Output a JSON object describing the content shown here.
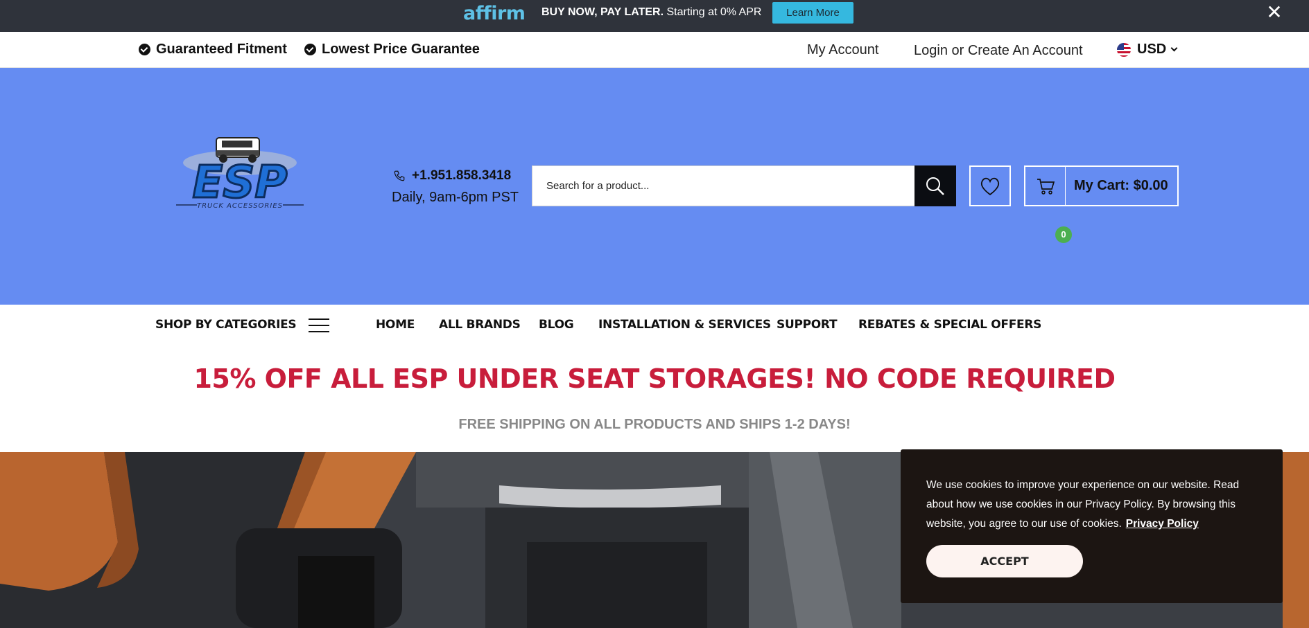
{
  "promo": {
    "brand": "affirm",
    "headline": "BUY NOW, PAY LATER.",
    "subtext": " Starting at 0% APR",
    "learn_more": "Learn More",
    "close": "✕"
  },
  "utility": {
    "guarantees": [
      "Guaranteed Fitment",
      "Lowest Price Guarantee"
    ],
    "my_account": "My Account",
    "login": "Login or Create An Account",
    "currency": "USD"
  },
  "header": {
    "logo_text": "ESP",
    "logo_tagline": "TRUCK ACCESSORIES",
    "phone": "+1.951.858.3418",
    "hours": "Daily, 9am-6pm PST",
    "search_placeholder": "Search for a product...",
    "cart_label": "My Cart: $0.00",
    "cart_count": "0"
  },
  "nav": {
    "categories": "SHOP BY CATEGORIES",
    "items": [
      "HOME",
      "ALL BRANDS",
      "BLOG",
      "INSTALLATION & SERVICES",
      "SUPPORT",
      "REBATES & SPECIAL OFFERS"
    ]
  },
  "banner": {
    "sale": "15% OFF ALL ESP UNDER SEAT STORAGES! NO CODE REQUIRED",
    "shipping": "FREE SHIPPING ON ALL PRODUCTS AND SHIPS 1-2 DAYS!"
  },
  "cookie": {
    "text": "We use cookies to improve your experience on our website. Read about how we use cookies in our Privacy Policy. By browsing this website, you agree to our use of cookies.",
    "link": "Privacy Policy",
    "accept": "ACCEPT"
  },
  "colors": {
    "promo_bg": "#2f333b",
    "header_bg": "#658cf2",
    "sale_red": "#c81d3b",
    "cart_badge": "#4caf50"
  }
}
